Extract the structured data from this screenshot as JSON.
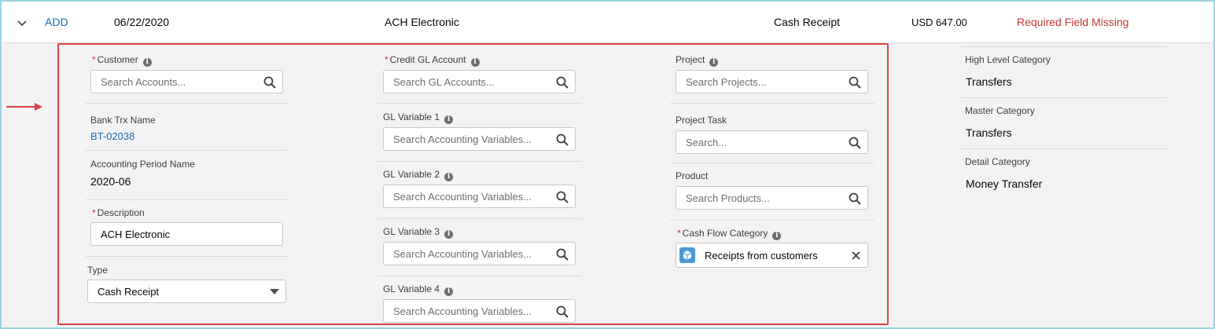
{
  "row": {
    "action": "ADD",
    "date": "06/22/2020",
    "description": "ACH Electronic",
    "type": "Cash Receipt",
    "amount": "USD 647.00",
    "status": "Required Field Missing"
  },
  "col1": {
    "customer_label": "Customer",
    "customer_placeholder": "Search Accounts...",
    "bank_trx_label": "Bank Trx Name",
    "bank_trx_value": "BT-02038",
    "period_label": "Accounting Period Name",
    "period_value": "2020-06",
    "description_label": "Description",
    "description_value": "ACH Electronic",
    "type_label": "Type",
    "type_value": "Cash Receipt"
  },
  "col2": {
    "credit_gl_label": "Credit GL Account",
    "credit_gl_placeholder": "Search GL Accounts...",
    "glv1_label": "GL Variable 1",
    "glv2_label": "GL Variable 2",
    "glv3_label": "GL Variable 3",
    "glv4_label": "GL Variable 4",
    "glv_placeholder": "Search Accounting Variables..."
  },
  "col3": {
    "project_label": "Project",
    "project_placeholder": "Search Projects...",
    "task_label": "Project Task",
    "task_placeholder": "Search...",
    "product_label": "Product",
    "product_placeholder": "Search Products...",
    "cashflow_label": "Cash Flow Category",
    "cashflow_value": "Receipts from customers"
  },
  "categories": {
    "high_label": "High Level Category",
    "high_value": "Transfers",
    "master_label": "Master Category",
    "master_value": "Transfers",
    "detail_label": "Detail Category",
    "detail_value": "Money Transfer"
  },
  "colors": {
    "link": "#1b6bb3",
    "error": "#c23934",
    "highlight_border": "#e0424a",
    "pill_icon": "#4a9ad9"
  }
}
